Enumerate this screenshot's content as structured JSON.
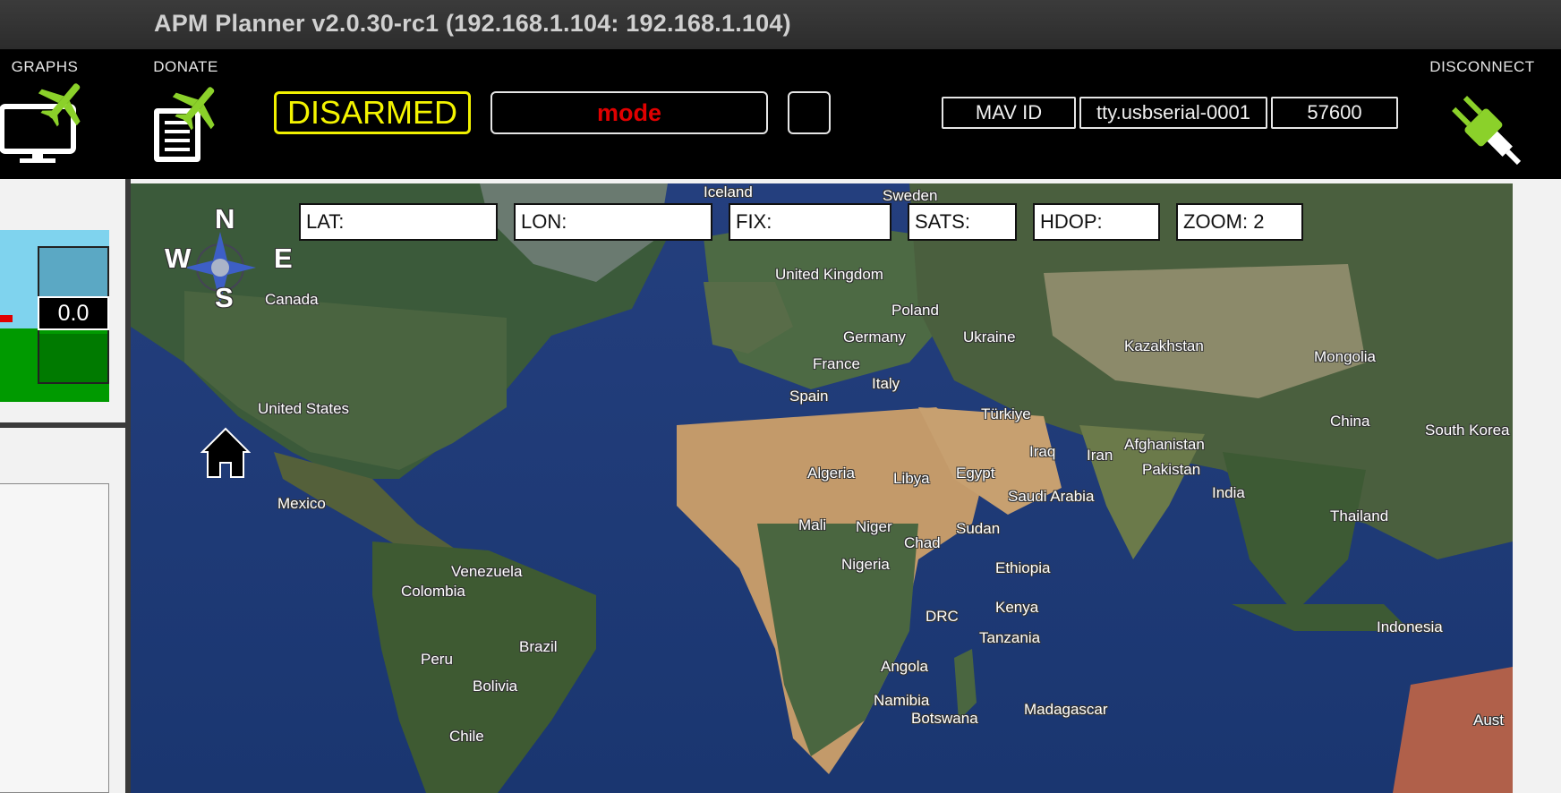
{
  "window": {
    "title": "APM Planner v2.0.30-rc1 (192.168.1.104: 192.168.1.104)"
  },
  "toolbar": {
    "graphs_label": "GRAPHS",
    "donate_label": "DONATE",
    "disconnect_label": "DISCONNECT",
    "arm_status": "DISARMED",
    "mode": "mode",
    "mav_id": "MAV ID",
    "port": "tty.usbserial-0001",
    "baud": "57600"
  },
  "hud": {
    "value": "0.0"
  },
  "map": {
    "lat_label": "LAT:",
    "lon_label": "LON:",
    "fix_label": "FIX:",
    "sats_label": "SATS:",
    "hdop_label": "HDOP:",
    "zoom_label": "ZOOM: 2",
    "compass": {
      "n": "N",
      "s": "S",
      "e": "E",
      "w": "W"
    },
    "places": [
      {
        "name": "Iceland"
      },
      {
        "name": "Sweden"
      },
      {
        "name": "United Kingdom"
      },
      {
        "name": "Poland"
      },
      {
        "name": "Germany"
      },
      {
        "name": "Ukraine"
      },
      {
        "name": "France"
      },
      {
        "name": "Italy"
      },
      {
        "name": "Spain"
      },
      {
        "name": "Kazakhstan"
      },
      {
        "name": "Mongolia"
      },
      {
        "name": "Türkiye"
      },
      {
        "name": "Canada"
      },
      {
        "name": "United States"
      },
      {
        "name": "Mexico"
      },
      {
        "name": "Iraq"
      },
      {
        "name": "Iran"
      },
      {
        "name": "Afghanistan"
      },
      {
        "name": "Pakistan"
      },
      {
        "name": "China"
      },
      {
        "name": "South Korea"
      },
      {
        "name": "Algeria"
      },
      {
        "name": "Libya"
      },
      {
        "name": "Egypt"
      },
      {
        "name": "Saudi Arabia"
      },
      {
        "name": "India"
      },
      {
        "name": "Thailand"
      },
      {
        "name": "Mali"
      },
      {
        "name": "Niger"
      },
      {
        "name": "Chad"
      },
      {
        "name": "Sudan"
      },
      {
        "name": "Nigeria"
      },
      {
        "name": "Ethiopia"
      },
      {
        "name": "Venezuela"
      },
      {
        "name": "Colombia"
      },
      {
        "name": "DRC"
      },
      {
        "name": "Kenya"
      },
      {
        "name": "Tanzania"
      },
      {
        "name": "Brazil"
      },
      {
        "name": "Peru"
      },
      {
        "name": "Bolivia"
      },
      {
        "name": "Angola"
      },
      {
        "name": "Namibia"
      },
      {
        "name": "Botswana"
      },
      {
        "name": "Madagascar"
      },
      {
        "name": "Indonesia"
      },
      {
        "name": "Chile"
      },
      {
        "name": "Aust"
      }
    ]
  },
  "colors": {
    "armed": "#f4f400",
    "mode": "#e00000",
    "plane": "#8bd12a",
    "plug": "#7ac142"
  }
}
